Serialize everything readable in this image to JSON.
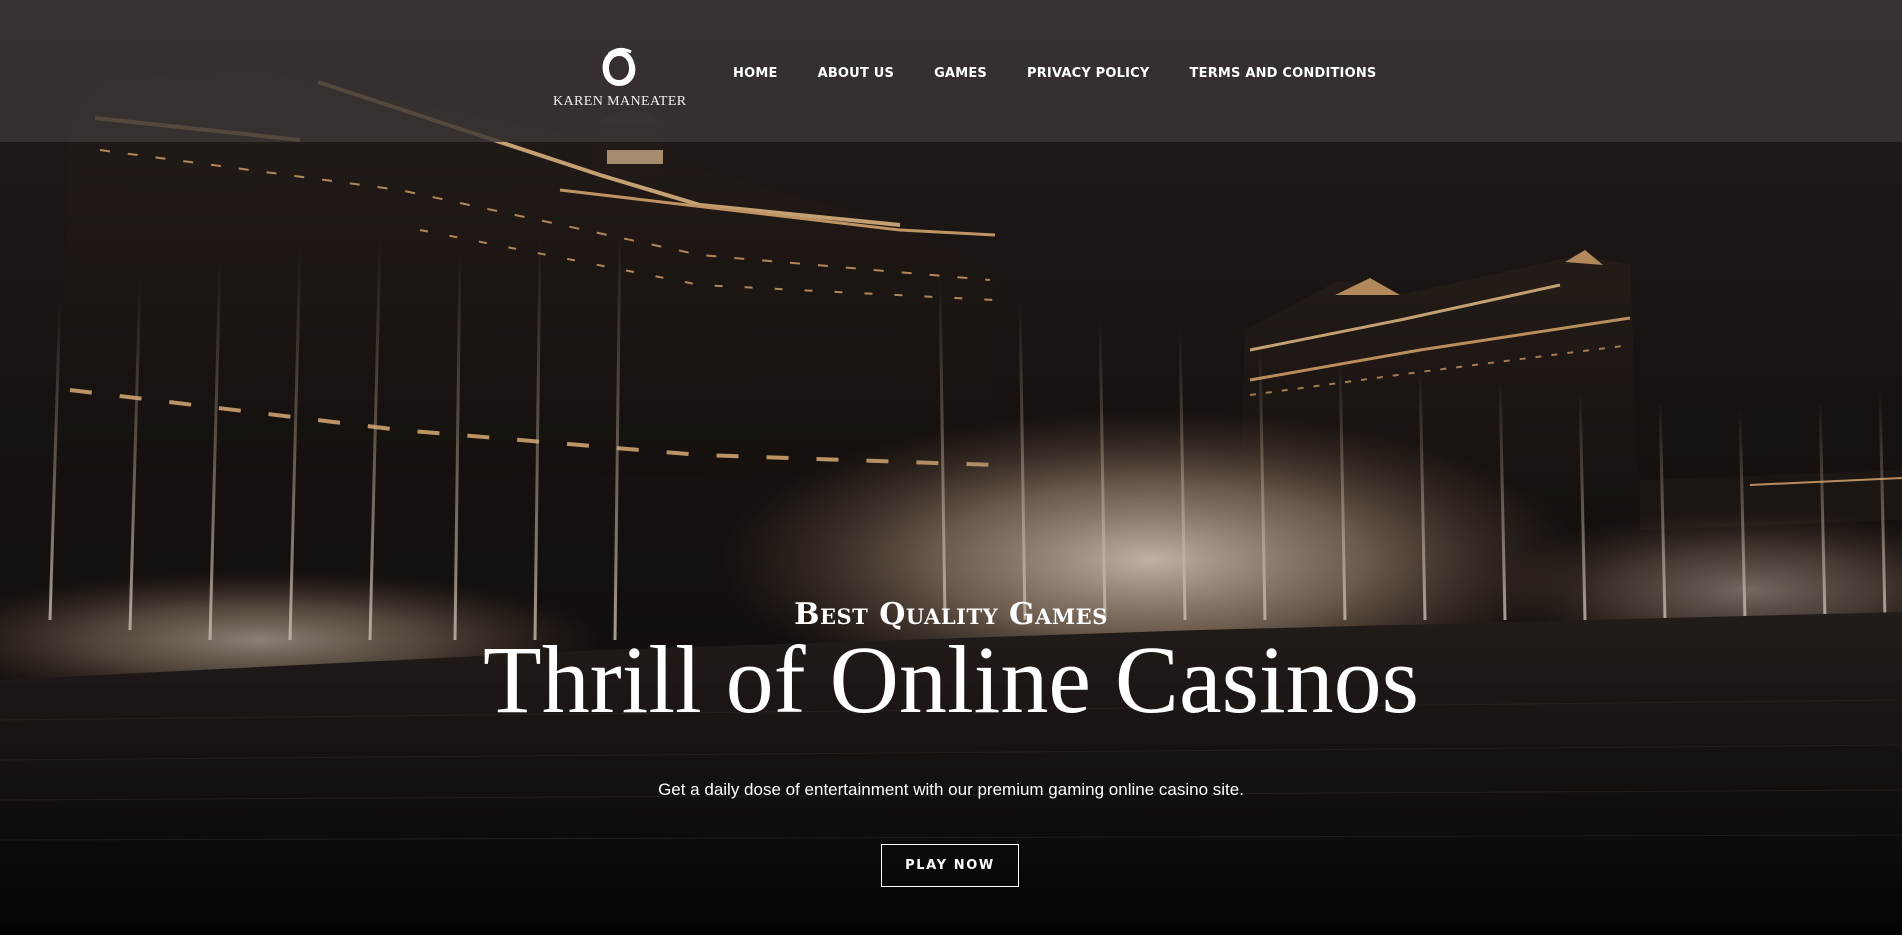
{
  "brand": {
    "name": "KAREN MANEATER",
    "logo_icon": "ring-logo-icon"
  },
  "nav": {
    "items": [
      {
        "label": "HOME"
      },
      {
        "label": "ABOUT US"
      },
      {
        "label": "GAMES"
      },
      {
        "label": "PRIVACY POLICY"
      },
      {
        "label": "TERMS AND CONDITIONS"
      }
    ]
  },
  "hero": {
    "subtitle": "Best Quality Games",
    "title": "Thrill of Online Casinos",
    "description": "Get a daily dose of entertainment with our premium gaming online casino site.",
    "cta_label": "PLAY NOW",
    "background_image": "night-fountain-casino-photo"
  },
  "colors": {
    "header_bg": "#3a3635",
    "text": "#ffffff",
    "glow": "#f0c48c"
  }
}
